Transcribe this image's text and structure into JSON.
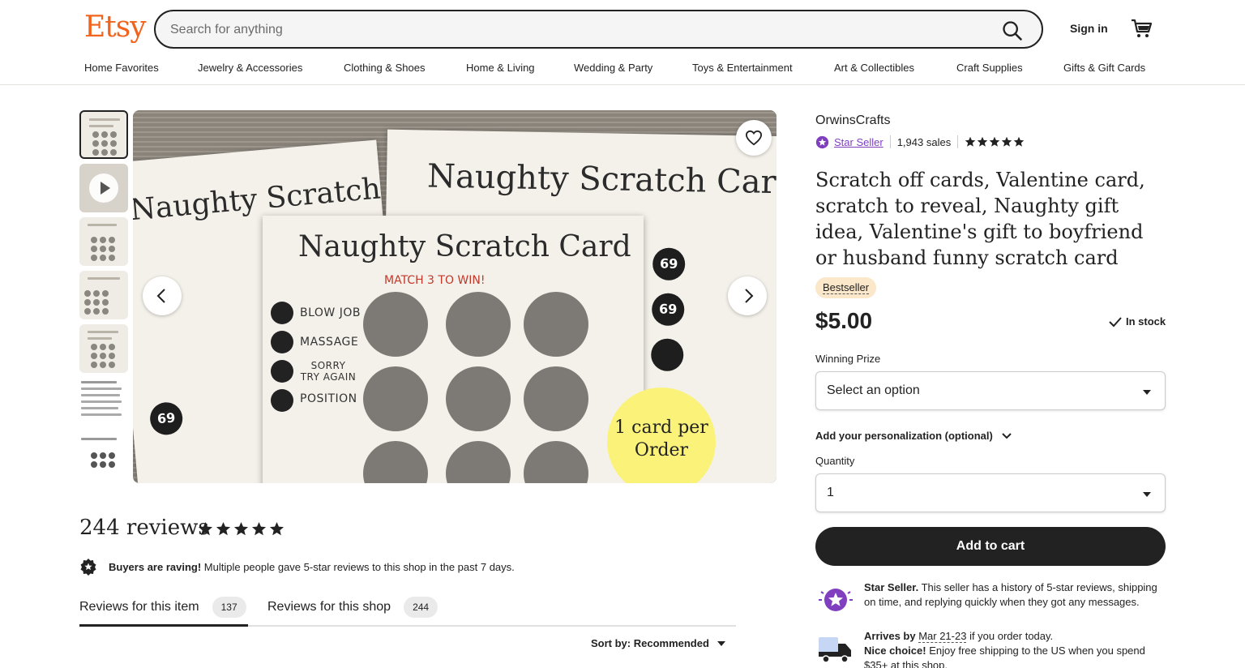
{
  "header": {
    "logo": "Etsy",
    "search_placeholder": "Search for anything",
    "sign_in": "Sign in",
    "brand_color": "#f1641e"
  },
  "nav": {
    "items": [
      "Home Favorites",
      "Jewelry & Accessories",
      "Clothing & Shoes",
      "Home & Living",
      "Wedding & Party",
      "Toys & Entertainment",
      "Art & Collectibles",
      "Craft Supplies",
      "Gifts & Gift Cards"
    ]
  },
  "gallery": {
    "image_card_title_front": "Naughty Scratch Card",
    "image_card_title_back": "Naughty Scratch Card",
    "image_match_text": "MATCH 3 TO WIN!",
    "image_prizes": [
      "BLOW JOB",
      "MASSAGE",
      "SORRY TRY AGAIN",
      "POSITION"
    ],
    "image_badge_69": "69",
    "image_sticker": "1 card per Order",
    "thumb_text_1": "Naughty Scratch Card",
    "thumb_text_2": "Naughty Scratch Card"
  },
  "listing": {
    "shop_name": "OrwinsCrafts",
    "star_seller_label": "Star Seller",
    "sales": "1,943 sales",
    "rating": 5,
    "title": "Scratch off cards, Valentine card, scratch to reveal, Naughty gift idea, Valentine's gift to boyfriend or husband funny scratch card",
    "badge": "Bestseller",
    "price": "$5.00",
    "stock": "In stock",
    "winning_prize_label": "Winning Prize",
    "winning_prize_value": "Select an option",
    "personalization": "Add your personalization (optional)",
    "quantity_label": "Quantity",
    "quantity_value": "1",
    "add_to_cart": "Add to cart",
    "star_seller_title": "Star Seller.",
    "star_seller_text": " This seller has a history of 5-star reviews, shipping on time, and replying quickly when they got any messages.",
    "arrives_prefix": "Arrives by ",
    "arrives_date": "Mar 21-23",
    "arrives_suffix": " if you order today.",
    "nice_choice_title": "Nice choice!",
    "nice_choice_text": " Enjoy free shipping to the US when you spend $35+ at this shop.",
    "star_seller_color": "#7f3fbf"
  },
  "reviews": {
    "count_label": "244 reviews",
    "rating": 5,
    "raving_title": "Buyers are raving!",
    "raving_text": " Multiple people gave 5-star reviews to this shop in the past 7 days.",
    "tab_item": "Reviews for this item",
    "tab_item_count": "137",
    "tab_shop": "Reviews for this shop",
    "tab_shop_count": "244",
    "sort_label": "Sort by: Recommended"
  }
}
